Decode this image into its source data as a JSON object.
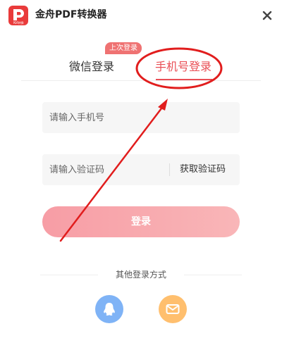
{
  "app": {
    "title": "金舟PDF转换器",
    "logo_text": "PDF转换"
  },
  "tabs": {
    "wechat_label": "微信登录",
    "phone_label": "手机号登录",
    "last_login_badge": "上次登录"
  },
  "form": {
    "phone_placeholder": "请输入手机号",
    "code_placeholder": "请输入验证码",
    "get_code_label": "获取验证码",
    "login_label": "登录"
  },
  "other_login": {
    "label": "其他登录方式",
    "methods": [
      "qq-icon",
      "mail-icon"
    ]
  },
  "colors": {
    "accent": "#e94e55",
    "logo_red": "#e93b3b",
    "qq": "#7fb3f6",
    "mail": "#ffbf6e",
    "annotation": "#e11d1d"
  }
}
